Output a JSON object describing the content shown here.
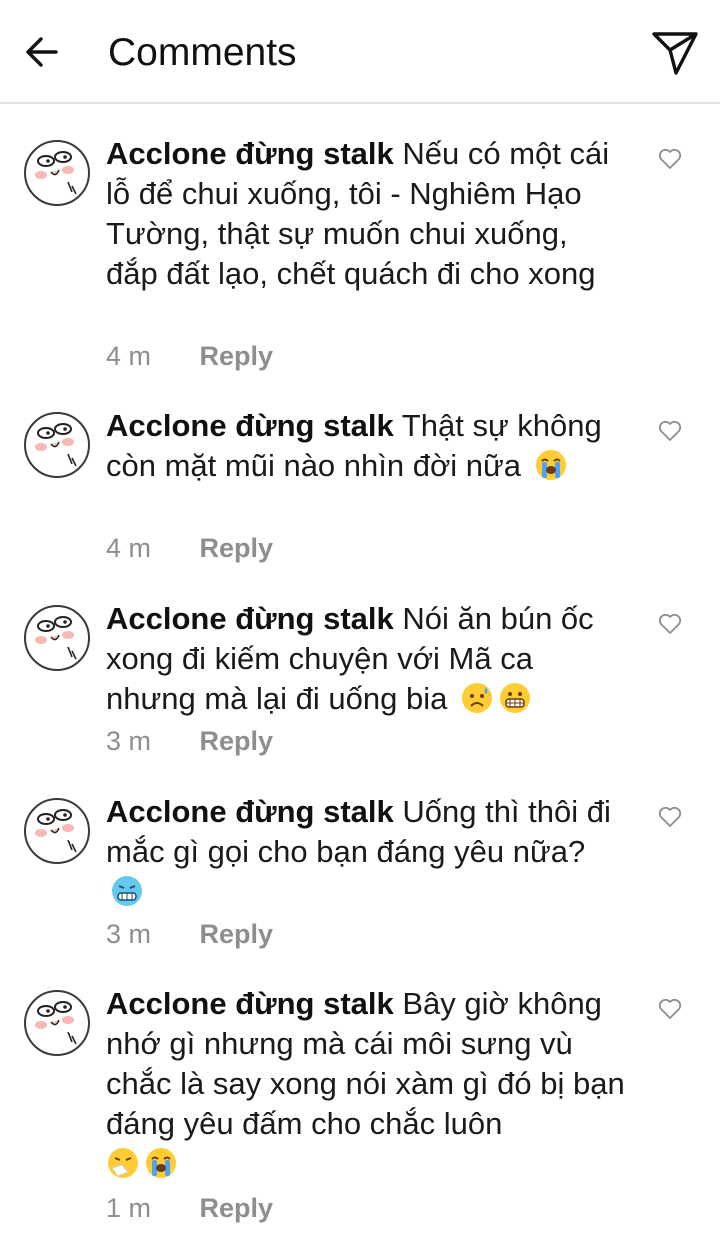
{
  "header": {
    "title": "Comments",
    "back_icon": "arrow-left-icon",
    "share_icon": "paper-plane-icon"
  },
  "comments": [
    {
      "username": "Acclone đừng stalk",
      "text": "Nếu có một cái lỗ để chui xuống, tôi - Nghiêm Hạo Tường, thật sự muốn chui xuống, đắp đất lạo, chết quách đi cho xong",
      "emojis": [],
      "time": "4 m",
      "reply_label": "Reply"
    },
    {
      "username": "Acclone đừng stalk",
      "text": "Thật sự không còn mặt mũi nào nhìn đời nữa",
      "emojis": [
        "loudly-crying-face-emoji"
      ],
      "time": "4 m",
      "reply_label": "Reply"
    },
    {
      "username": "Acclone đừng stalk",
      "text": "Nói ăn bún ốc xong đi kiếm chuyện với Mã ca nhưng mà lại đi uống bia",
      "emojis": [
        "sad-but-relieved-face-emoji",
        "grimacing-face-emoji"
      ],
      "time": "3 m",
      "reply_label": "Reply"
    },
    {
      "username": "Acclone đừng stalk",
      "text": "Uống thì thôi đi mắc gì gọi cho bạn đáng yêu nữa?",
      "emojis": [
        "cold-face-emoji"
      ],
      "time": "3 m",
      "reply_label": "Reply"
    },
    {
      "username": "Acclone đừng stalk",
      "text": "Bây giờ không nhớ gì nhưng mà cái môi sưng vù chắc là say xong nói xàm gì đó bị bạn đáng yêu đấm cho chắc luôn",
      "emojis": [
        "sneezing-face-emoji",
        "loudly-crying-face-emoji"
      ],
      "time": "1 m",
      "reply_label": "Reply"
    }
  ]
}
